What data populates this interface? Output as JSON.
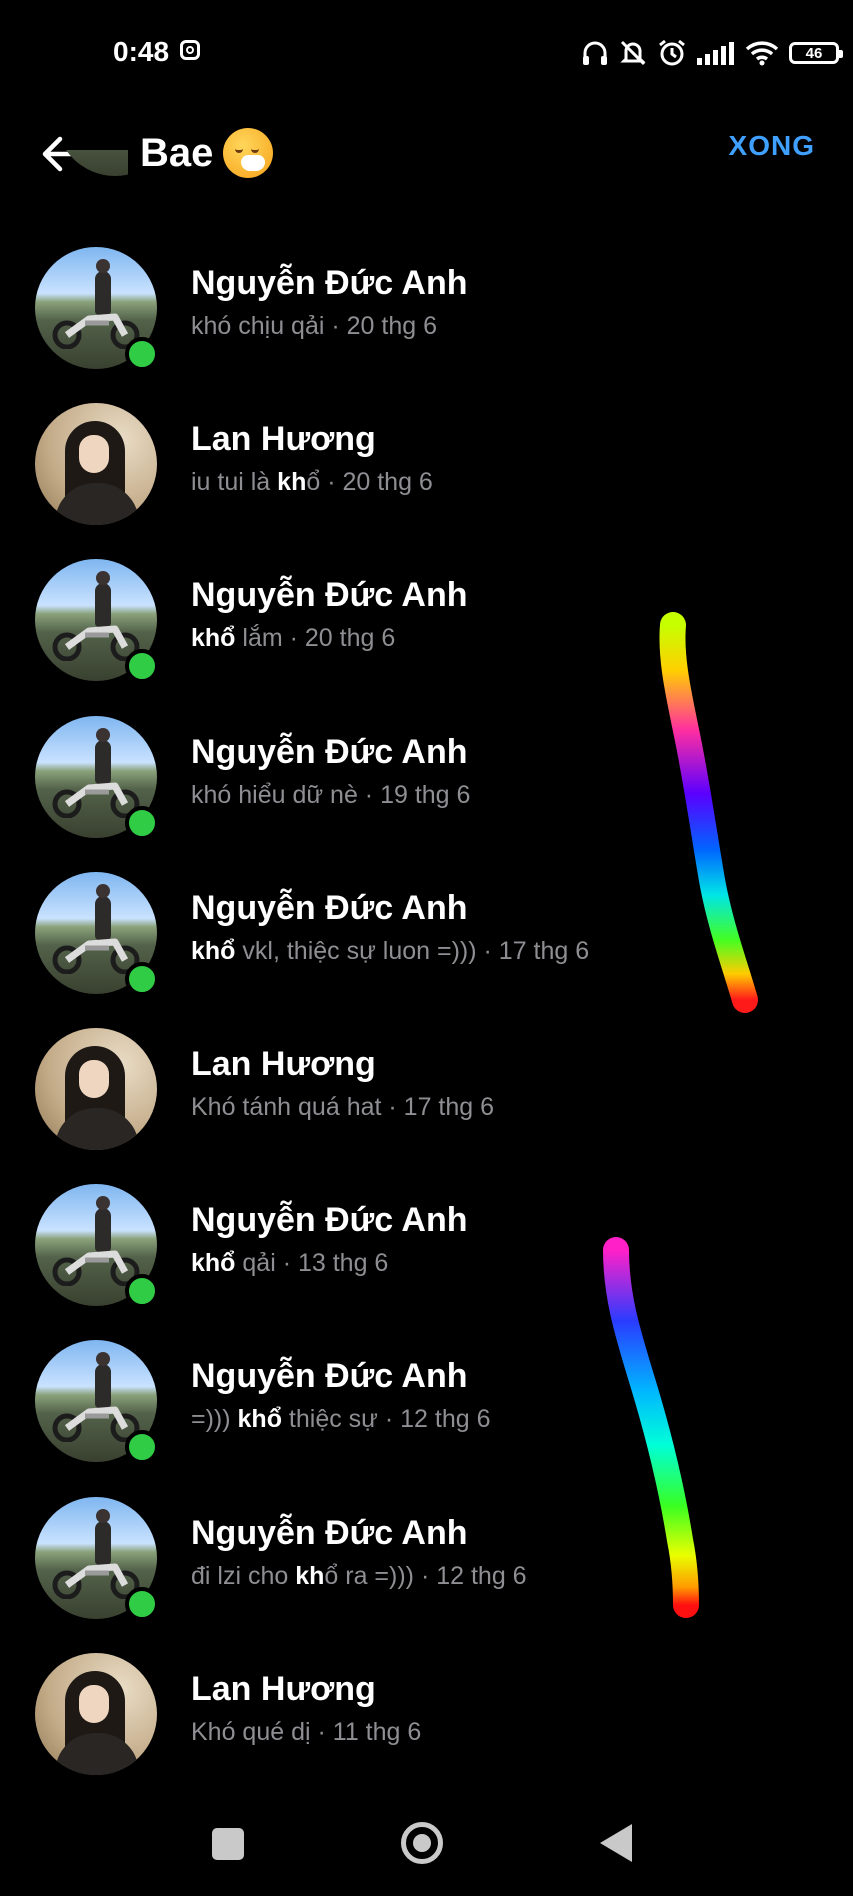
{
  "status_bar": {
    "time": "0:48",
    "battery": "46",
    "icons": [
      "instagram-icon",
      "headphones-icon",
      "bell-off-icon",
      "alarm-icon",
      "signal-icon",
      "wifi-icon",
      "battery-icon"
    ]
  },
  "header": {
    "back_icon": "arrow-left-icon",
    "title": "Bae",
    "title_emoji": "face-with-hand-over-mouth-emoji",
    "done_label": "XONG",
    "done_color": "#3fa0ff"
  },
  "results": [
    {
      "name": "Nguyễn Đức Anh",
      "avatar": "moto",
      "online": true,
      "preview": {
        "before": "khó chịu qải",
        "highlight": "",
        "after": "",
        "date": "20 thg 6"
      }
    },
    {
      "name": "Lan Hương",
      "avatar": "girl",
      "online": false,
      "preview": {
        "before": "iu tui là ",
        "highlight": "kh",
        "after": "ổ",
        "date": "20 thg 6"
      }
    },
    {
      "name": "Nguyễn Đức Anh",
      "avatar": "moto",
      "online": true,
      "preview": {
        "before": "",
        "highlight": "khổ",
        "after": " lắm",
        "date": "20 thg 6"
      }
    },
    {
      "name": "Nguyễn Đức Anh",
      "avatar": "moto",
      "online": true,
      "preview": {
        "before": "khó hiểu dữ nè",
        "highlight": "",
        "after": "",
        "date": "19 thg 6"
      }
    },
    {
      "name": "Nguyễn Đức Anh",
      "avatar": "moto",
      "online": true,
      "preview": {
        "before": "",
        "highlight": "khổ",
        "after": " vkl, thiệc sự luon =)))",
        "date": "17 thg 6"
      }
    },
    {
      "name": "Lan Hương",
      "avatar": "girl",
      "online": false,
      "preview": {
        "before": "Khó tánh quá hat",
        "highlight": "",
        "after": "",
        "date": "17 thg 6"
      }
    },
    {
      "name": "Nguyễn Đức Anh",
      "avatar": "moto",
      "online": true,
      "preview": {
        "before": "",
        "highlight": "khổ",
        "after": " qải",
        "date": "13 thg 6"
      }
    },
    {
      "name": "Nguyễn Đức Anh",
      "avatar": "moto",
      "online": true,
      "preview": {
        "before": "=))) ",
        "highlight": "khổ",
        "after": " thiệc sự",
        "date": "12 thg 6"
      }
    },
    {
      "name": "Nguyễn Đức Anh",
      "avatar": "moto",
      "online": true,
      "preview": {
        "before": "đi lzi cho ",
        "highlight": "kh",
        "after": "ổ ra =)))",
        "date": "12 thg 6"
      }
    },
    {
      "name": "Lan Hương",
      "avatar": "girl",
      "online": false,
      "preview": {
        "before": "Khó qué dị",
        "highlight": "",
        "after": "",
        "date": "11 thg 6"
      }
    }
  ],
  "separator": " · ",
  "online_color": "#31cc46",
  "nav_bar": {
    "icons": [
      "recent-apps-icon",
      "home-icon",
      "back-triangle-icon"
    ]
  }
}
